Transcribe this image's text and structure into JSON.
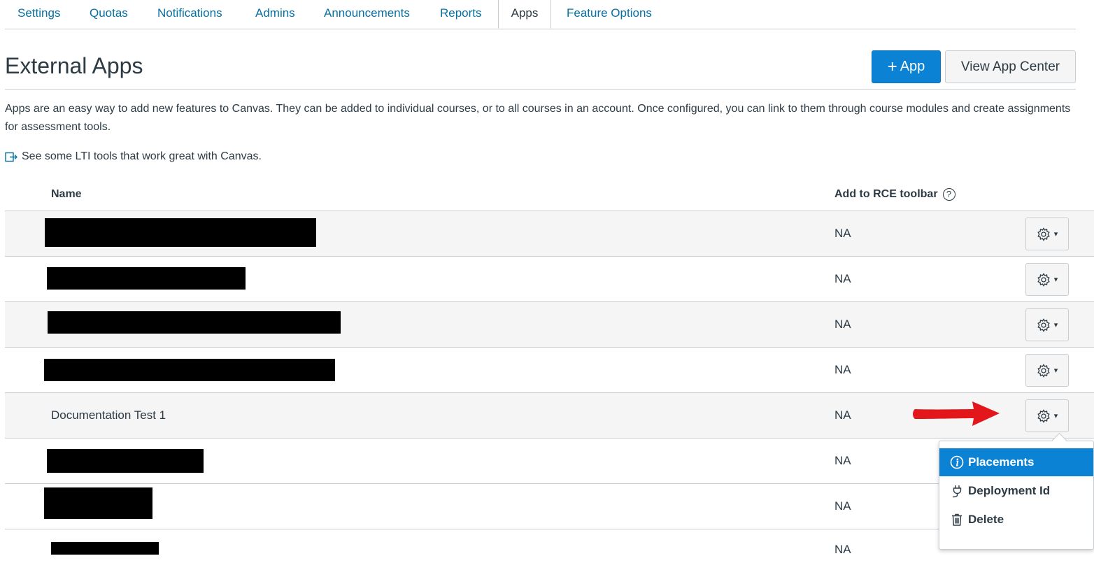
{
  "tabs": [
    {
      "label": "Settings"
    },
    {
      "label": "Quotas"
    },
    {
      "label": "Notifications"
    },
    {
      "label": "Admins"
    },
    {
      "label": "Announcements"
    },
    {
      "label": "Reports"
    },
    {
      "label": "Apps"
    },
    {
      "label": "Feature Options"
    }
  ],
  "active_tab": "Apps",
  "page": {
    "title": "External Apps",
    "add_app_plus": "+",
    "add_app_label": "App",
    "view_app_center_label": "View App Center",
    "description": "Apps are an easy way to add new features to Canvas. They can be added to individual courses, or to all courses in an account. Once configured, you can link to them through course modules and create assignments for assessment tools.",
    "lti_link_text": "See some LTI tools that work great with Canvas."
  },
  "table": {
    "columns": {
      "name": "Name",
      "rce": "Add to RCE toolbar",
      "help_glyph": "?"
    },
    "rows": [
      {
        "name": "",
        "redacted": true,
        "rce": "NA"
      },
      {
        "name": "",
        "redacted": true,
        "rce": "NA"
      },
      {
        "name": "",
        "redacted": true,
        "rce": "NA"
      },
      {
        "name": "",
        "redacted": true,
        "rce": "NA"
      },
      {
        "name": "Documentation Test 1",
        "redacted": false,
        "rce": "NA"
      },
      {
        "name": "",
        "redacted": true,
        "rce": "NA"
      },
      {
        "name": "",
        "redacted": true,
        "rce": "NA"
      },
      {
        "name": "",
        "redacted": true,
        "rce": "NA"
      }
    ],
    "gear_caret": "▾"
  },
  "menu": {
    "items": [
      {
        "label": "Placements",
        "icon": "info-icon",
        "active": true
      },
      {
        "label": "Deployment Id",
        "icon": "plug-icon",
        "active": false
      },
      {
        "label": "Delete",
        "icon": "trash-icon",
        "active": false
      }
    ]
  },
  "colors": {
    "link": "#0770a3",
    "primary": "#0b82d4",
    "text": "#2d3b45",
    "border": "#c7cdd1",
    "row_alt": "#f5f5f5",
    "annotation_arrow": "#e3161b"
  }
}
